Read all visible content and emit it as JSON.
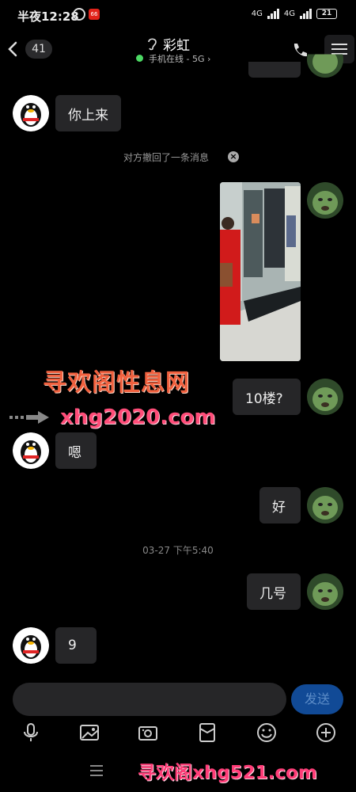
{
  "status_bar": {
    "time": "半夜12:28",
    "notification_badge": "66",
    "network1": "4G",
    "network2": "4G",
    "battery": "21"
  },
  "header": {
    "unread_count": "41",
    "title": "彩虹",
    "online_status": "手机在线 - 5G ›"
  },
  "messages": [
    {
      "side": "left",
      "text": "你上来"
    },
    {
      "side": "system",
      "text": "对方撤回了一条消息"
    },
    {
      "side": "right",
      "type": "image"
    },
    {
      "side": "right",
      "text": "10楼?"
    },
    {
      "side": "left",
      "text": "嗯"
    },
    {
      "side": "right",
      "text": "好"
    },
    {
      "side": "time",
      "text": "03-27 下午5:40"
    },
    {
      "side": "right",
      "text": "几号"
    },
    {
      "side": "left",
      "text": "9"
    }
  ],
  "watermark": {
    "title": "寻欢阁性息网",
    "url": "xhg2020.com",
    "bottom": "寻欢阁xhg521.com"
  },
  "input": {
    "placeholder": "",
    "send_label": "发送"
  },
  "toolbar": [
    "mic-icon",
    "image-icon",
    "camera-icon",
    "red-packet-icon",
    "emoji-icon",
    "plus-icon"
  ],
  "colors": {
    "background": "#000000",
    "bubble": "#262628",
    "online": "#4cd964",
    "send_button": "#114a96"
  }
}
